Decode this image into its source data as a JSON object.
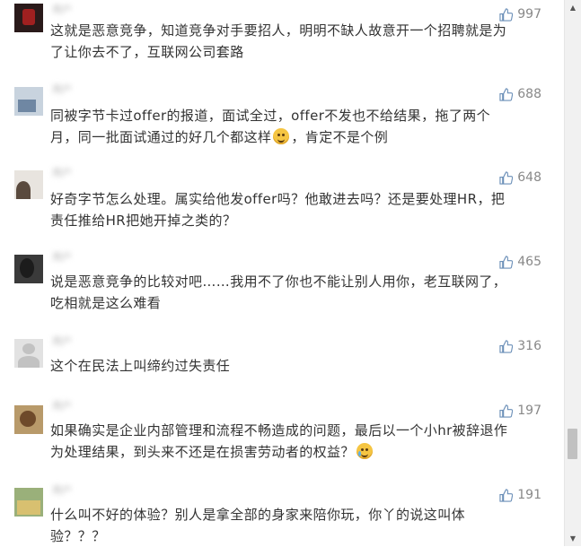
{
  "comments": [
    {
      "username": "用户",
      "likes": "997",
      "lines": [
        "这就是恶意竞争，知道竞争对手要招人，明明不缺人故意开一个招聘就是为",
        "了让你去不了，互联网公司套路"
      ]
    },
    {
      "username": "用户",
      "likes": "688",
      "lines": [
        "同被字节卡过offer的报道，面试全过，offer不发也不给结果，拖了两个",
        "月，同一批面试通过的好几个都这样"
      ],
      "line2_suffix": "，肯定不是个例"
    },
    {
      "username": "用户",
      "likes": "648",
      "lines": [
        "好奇字节怎么处理。属实给他发offer吗？他敢进去吗？还是要处理HR，把",
        "责任推给HR把她开掉之类的？"
      ]
    },
    {
      "username": "用户",
      "likes": "465",
      "lines": [
        "说是恶意竞争的比较对吧……我用不了你也不能让别人用你，老互联网了，",
        "吃相就是这么难看"
      ]
    },
    {
      "username": "用户",
      "likes": "316",
      "lines": [
        "这个在民法上叫缔约过失责任"
      ]
    },
    {
      "username": "用户",
      "likes": "197",
      "lines": [
        "如果确实是企业内部管理和流程不畅造成的问题，最后以一个小hr被辞退作",
        "为处理结果，到头来不还是在损害劳动者的权益？"
      ]
    },
    {
      "username": "用户",
      "likes": "191",
      "lines": [
        "什么叫不好的体验？别人是拿全部的身家来陪你玩，你丫的说这叫体",
        "验？？？"
      ]
    }
  ],
  "icons": {
    "like": "thumbs-up-icon",
    "emoji_smile": "smiling-emoji-icon",
    "emoji_cry": "crying-emoji-icon"
  },
  "colors": {
    "text": "#333333",
    "like_count": "#888888",
    "like_icon": "#6b8fb8"
  }
}
